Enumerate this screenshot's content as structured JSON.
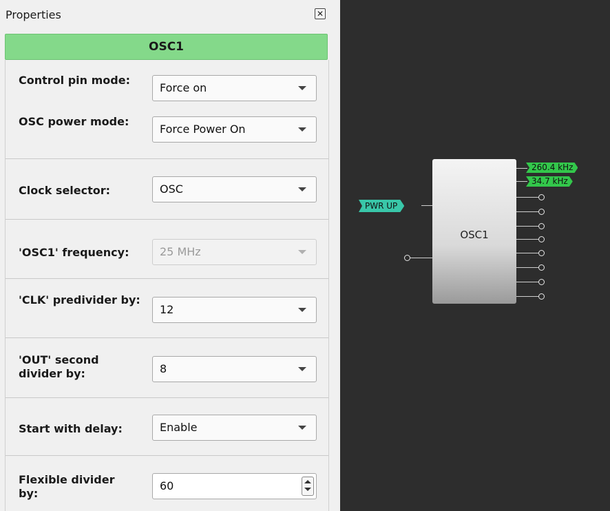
{
  "panel": {
    "title": "Properties",
    "close_icon": "close-icon",
    "component_name": "OSC1"
  },
  "properties": {
    "control_pin_mode": {
      "label": "Control pin mode:",
      "value": "Force on"
    },
    "osc_power_mode": {
      "label": "OSC power mode:",
      "value": "Force Power On"
    },
    "clock_selector": {
      "label": "Clock selector:",
      "value": "OSC"
    },
    "osc1_frequency": {
      "label": "'OSC1' frequency:",
      "value": "25 MHz"
    },
    "clk_predivider": {
      "label": "'CLK' predivider by:",
      "value": "12"
    },
    "out_second_divider": {
      "label": "'OUT' second divider by:",
      "value": "8"
    },
    "start_with_delay": {
      "label": "Start with delay:",
      "value": "Enable"
    },
    "flexible_divider": {
      "label": "Flexible divider by:",
      "value": "60"
    }
  },
  "canvas": {
    "block_label": "OSC1",
    "input_tag": "PWR UP",
    "output_tags": [
      "260.4 kHz",
      "34.7 kHz"
    ],
    "colors": {
      "background": "#2d2d2d",
      "input_tag": "#39c7a9",
      "output_tag": "#33c74b",
      "header": "#84d98a"
    }
  }
}
